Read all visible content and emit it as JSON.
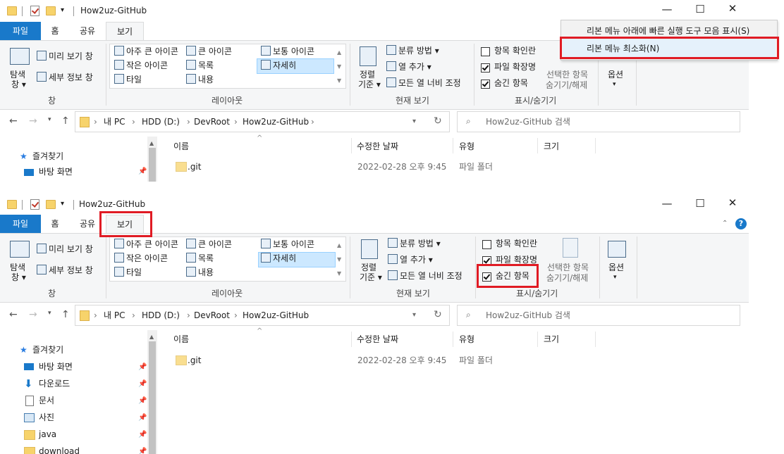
{
  "window": {
    "title": "How2uz-GitHub",
    "tabs": {
      "file": "파일",
      "home": "홈",
      "share": "공유",
      "view": "보기"
    },
    "pane": {
      "nav_pane_1": "탐색",
      "nav_pane_2": "창",
      "preview": "미리 보기 창",
      "details": "세부 정보 창",
      "group": "창"
    },
    "layout": {
      "items": [
        "아주 큰 아이콘",
        "큰 아이콘",
        "보통 아이콘",
        "작은 아이콘",
        "목록",
        "자세히",
        "타일",
        "내용"
      ],
      "group": "레이아웃"
    },
    "current_view": {
      "sort_1": "정렬",
      "sort_2": "기준",
      "group_by": "분류 방법",
      "add_column": "열 추가",
      "fit_columns": "모든 열 너비 조정",
      "group": "현재 보기"
    },
    "show_hide": {
      "item_checkbox": "항목 확인란",
      "file_ext": "파일 확장명",
      "hidden_items": "숨긴 항목",
      "hide_selected_1": "선택한 항목",
      "hide_selected_2": "숨기기/해제",
      "options": "옵션",
      "group": "표시/숨기기",
      "checks": {
        "item_checkbox": false,
        "file_ext": true,
        "hidden_items": true
      }
    },
    "address": {
      "crumbs": [
        "내 PC",
        "HDD (D:)",
        "DevRoot",
        "How2uz-GitHub"
      ],
      "search_placeholder": "How2uz-GitHub 검색"
    },
    "columns": {
      "name": "이름",
      "modified": "수정한 날짜",
      "type": "유형",
      "size": "크기"
    },
    "files": [
      {
        "name": ".git",
        "modified": "2022-02-28 오후 9:45",
        "type": "파일 폴더"
      }
    ],
    "sidebar": {
      "quick_access": "즐겨찾기",
      "items": [
        "바탕 화면",
        "다운로드",
        "문서",
        "사진",
        "java",
        "download"
      ]
    }
  },
  "context_menu": {
    "items": [
      "리본 메뉴 아래에 빠른 실행 도구 모음 표시(S)",
      "리본 메뉴 최소화(N)"
    ]
  },
  "colors": {
    "accent": "#1979ca",
    "highlight_box": "#e01b24",
    "selection": "#cce8ff"
  }
}
